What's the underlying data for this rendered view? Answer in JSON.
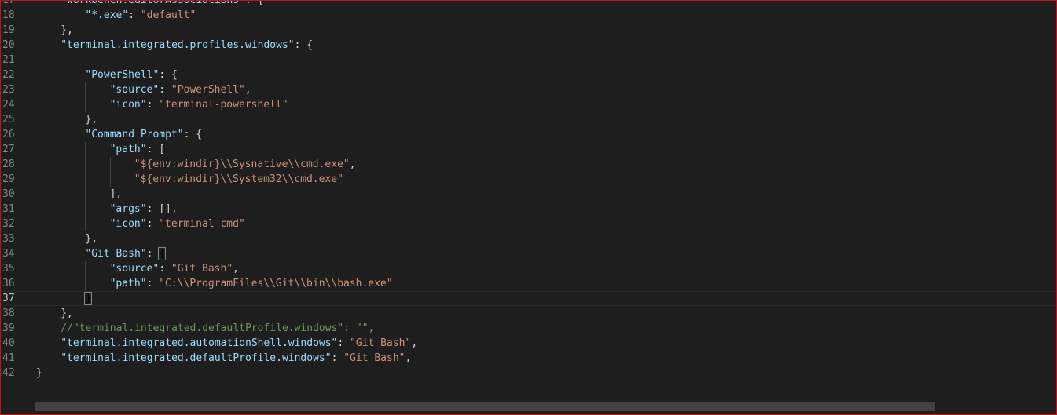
{
  "editor": {
    "lines": [
      {
        "n": "17",
        "indent": 1,
        "segs": [
          [
            "k",
            "\"workbench.editorAssociations\""
          ],
          [
            "p",
            ": {"
          ]
        ]
      },
      {
        "n": "18",
        "indent": 2,
        "segs": [
          [
            "k",
            "\"*.exe\""
          ],
          [
            "p",
            ": "
          ],
          [
            "s",
            "\"default\""
          ]
        ]
      },
      {
        "n": "19",
        "indent": 1,
        "segs": [
          [
            "p",
            "},"
          ]
        ]
      },
      {
        "n": "20",
        "indent": 1,
        "segs": [
          [
            "k",
            "\"terminal.integrated.profiles.windows\""
          ],
          [
            "p",
            ": {"
          ]
        ]
      },
      {
        "n": "21",
        "indent": 0,
        "segs": []
      },
      {
        "n": "22",
        "indent": 2,
        "segs": [
          [
            "k",
            "\"PowerShell\""
          ],
          [
            "p",
            ": {"
          ]
        ]
      },
      {
        "n": "23",
        "indent": 3,
        "segs": [
          [
            "k",
            "\"source\""
          ],
          [
            "p",
            ": "
          ],
          [
            "s",
            "\"PowerShell\""
          ],
          [
            "p",
            ","
          ]
        ]
      },
      {
        "n": "24",
        "indent": 3,
        "segs": [
          [
            "k",
            "\"icon\""
          ],
          [
            "p",
            ": "
          ],
          [
            "s",
            "\"terminal-powershell\""
          ]
        ]
      },
      {
        "n": "25",
        "indent": 2,
        "segs": [
          [
            "p",
            "},"
          ]
        ]
      },
      {
        "n": "26",
        "indent": 2,
        "segs": [
          [
            "k",
            "\"Command Prompt\""
          ],
          [
            "p",
            ": {"
          ]
        ]
      },
      {
        "n": "27",
        "indent": 3,
        "segs": [
          [
            "k",
            "\"path\""
          ],
          [
            "p",
            ": ["
          ]
        ]
      },
      {
        "n": "28",
        "indent": 4,
        "segs": [
          [
            "s",
            "\"${env:windir}\\\\Sysnative\\\\cmd.exe\""
          ],
          [
            "p",
            ","
          ]
        ]
      },
      {
        "n": "29",
        "indent": 4,
        "segs": [
          [
            "s",
            "\"${env:windir}\\\\System32\\\\cmd.exe\""
          ]
        ]
      },
      {
        "n": "30",
        "indent": 3,
        "segs": [
          [
            "p",
            "],"
          ]
        ]
      },
      {
        "n": "31",
        "indent": 3,
        "segs": [
          [
            "k",
            "\"args\""
          ],
          [
            "p",
            ": [],"
          ]
        ]
      },
      {
        "n": "32",
        "indent": 3,
        "segs": [
          [
            "k",
            "\"icon\""
          ],
          [
            "p",
            ": "
          ],
          [
            "s",
            "\"terminal-cmd\""
          ]
        ]
      },
      {
        "n": "33",
        "indent": 2,
        "segs": [
          [
            "p",
            "},"
          ]
        ]
      },
      {
        "n": "34",
        "indent": 2,
        "segs": [
          [
            "k",
            "\"Git Bash\""
          ],
          [
            "p",
            ": "
          ],
          [
            "bm",
            "{"
          ]
        ]
      },
      {
        "n": "35",
        "indent": 3,
        "segs": [
          [
            "k",
            "\"source\""
          ],
          [
            "p",
            ": "
          ],
          [
            "s",
            "\"Git Bash\""
          ],
          [
            "p",
            ","
          ]
        ]
      },
      {
        "n": "36",
        "indent": 3,
        "segs": [
          [
            "k",
            "\"path\""
          ],
          [
            "p",
            ": "
          ],
          [
            "s",
            "\"C:\\\\ProgramFiles\\\\Git\\\\bin\\\\bash.exe\""
          ]
        ]
      },
      {
        "n": "37",
        "indent": 2,
        "current": true,
        "segs": [
          [
            "bm",
            "}"
          ]
        ]
      },
      {
        "n": "38",
        "indent": 1,
        "segs": [
          [
            "p",
            "},"
          ]
        ]
      },
      {
        "n": "39",
        "indent": 1,
        "segs": [
          [
            "c",
            "//\"terminal.integrated.defaultProfile.windows\": \"\","
          ]
        ]
      },
      {
        "n": "40",
        "indent": 1,
        "segs": [
          [
            "k",
            "\"terminal.integrated.automationShell.windows\""
          ],
          [
            "p",
            ": "
          ],
          [
            "s",
            "\"Git Bash\""
          ],
          [
            "p",
            ","
          ]
        ]
      },
      {
        "n": "41",
        "indent": 1,
        "segs": [
          [
            "k",
            "\"terminal.integrated.defaultProfile.windows\""
          ],
          [
            "p",
            ": "
          ],
          [
            "s",
            "\"Git Bash\""
          ],
          [
            "p",
            ","
          ]
        ]
      },
      {
        "n": "42",
        "indent": 0,
        "segs": [
          [
            "p",
            "}"
          ]
        ]
      }
    ]
  },
  "colors": {
    "background": "#1e1e1e",
    "key": "#9cdcfe",
    "string": "#ce9178",
    "punctuation": "#d4d4d4",
    "comment": "#6a9955",
    "line_number": "#858585",
    "border": "#c4101b"
  }
}
